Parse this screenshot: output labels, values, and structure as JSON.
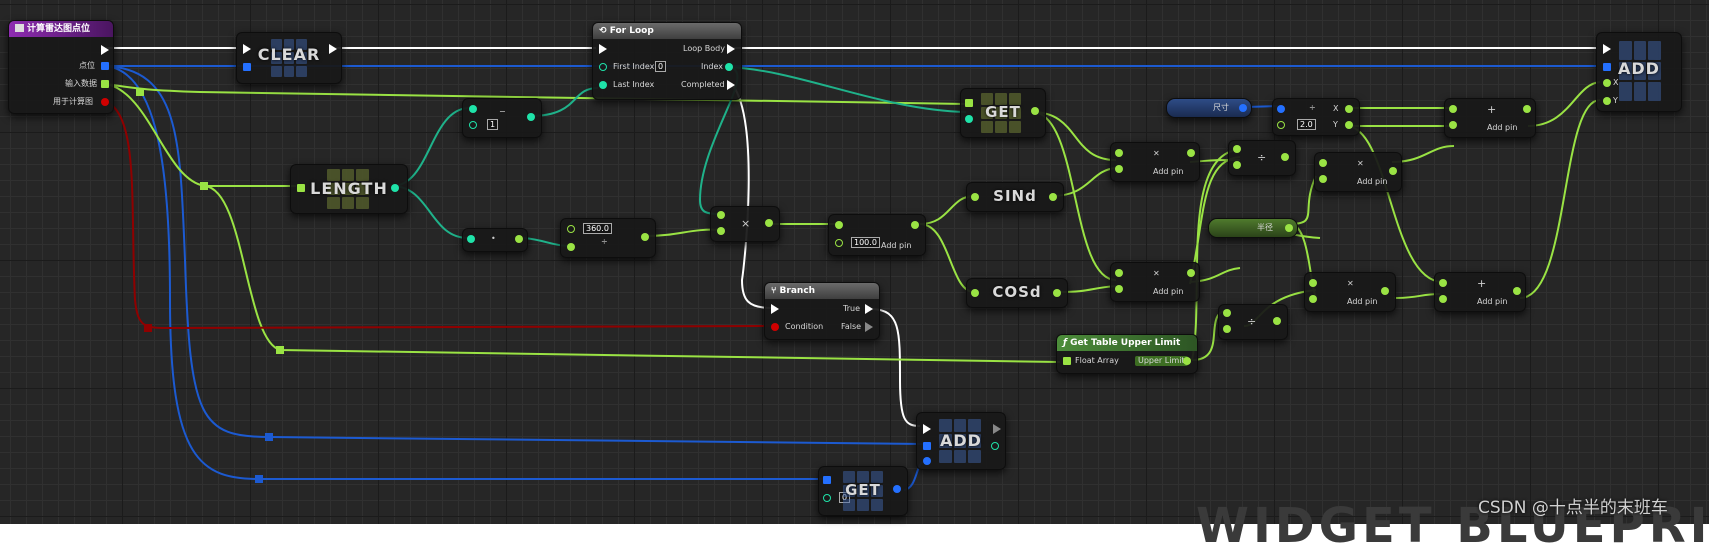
{
  "colors": {
    "exec": "#ffffff",
    "vector": "#f3d033",
    "float_array": "#9ae344",
    "float": "#9fe449",
    "integer": "#1fe3a9",
    "boolean": "#960000",
    "struct_array": "#2470ff",
    "event_header": "#8e2cb1",
    "loop_header": "#5f5f5f",
    "pure_header": "#4c8d3a"
  },
  "event": {
    "title": "计算雷达图点位",
    "pins": [
      "点位",
      "输入数据",
      "用于计算图"
    ]
  },
  "clear_node": {
    "label": "CLEAR"
  },
  "for_loop": {
    "title": "For Loop",
    "first_index_label": "First Index",
    "first_index_value": "0",
    "last_index_label": "Last Index",
    "loop_body_label": "Loop Body",
    "index_label": "Index",
    "completed_label": "Completed"
  },
  "length_node": {
    "label": "LENGTH"
  },
  "subtract_node": {
    "value": "1"
  },
  "dot_node": {
    "label": "•"
  },
  "divide_360": {
    "value": "360.0"
  },
  "multiply_angle": {
    "label": "×"
  },
  "multiply_100": {
    "value": "100.0",
    "add_pin": "Add pin"
  },
  "get_node": {
    "label": "GET"
  },
  "sin_node": {
    "label": "SINd"
  },
  "cos_node": {
    "label": "COSd"
  },
  "mult_sin": {
    "add_pin": "Add pin"
  },
  "mult_cos": {
    "add_pin": "Add pin"
  },
  "size_var": {
    "label": "尺寸"
  },
  "break_vec": {
    "x": "X",
    "y": "Y",
    "value": "2.0"
  },
  "radius_var": {
    "label": "半径"
  },
  "div_top": {
    "op": "÷"
  },
  "div_bottom": {
    "op": "÷"
  },
  "mult_r1": {
    "add_pin": "Add pin"
  },
  "mult_r2": {
    "add_pin": "Add pin"
  },
  "add_top": {
    "add_pin": "Add pin"
  },
  "add_bottom": {
    "add_pin": "Add pin"
  },
  "add_final": {
    "label": "ADD",
    "x": "X",
    "y": "Y"
  },
  "branch": {
    "title": "Branch",
    "condition": "Condition",
    "true_label": "True",
    "false_label": "False"
  },
  "get_table": {
    "title": "Get Table Upper Limit",
    "in_label": "Float Array",
    "out_label": "Upper Limit"
  },
  "add_bottom_array": {
    "label": "ADD"
  },
  "get_bottom": {
    "label": "GET",
    "value": "0"
  },
  "watermark": "WIDGET BLUEPRINT",
  "credit": "CSDN @十点半的末班车"
}
